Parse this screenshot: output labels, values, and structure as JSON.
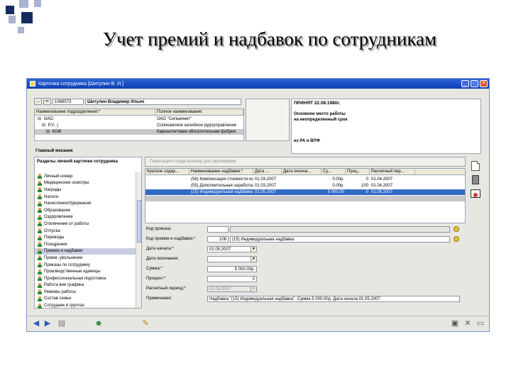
{
  "slide": {
    "title": "Учет премий и надбавок по сотрудникам",
    "colors": {
      "dark_square": "#172c5e",
      "light_square": "#aab3cf"
    }
  },
  "window": {
    "title": "Карточка сотрудника [Шитулин В. И.]",
    "controls": {
      "minimize": "_",
      "maximize": "□",
      "close": "✕"
    }
  },
  "employee": {
    "tab_number": "1068573",
    "name": "Шитулин Владимир Ильич",
    "status_header": "ПРИНЯТ 22.08.1980г.",
    "status_lines": [
      "Основное место работы",
      "на неопределенный срок",
      "из РА и ВПФ"
    ]
  },
  "org_table": {
    "columns": [
      "Наименование подразделения:*",
      "Полное наименование:"
    ],
    "rows": [
      {
        "short": "ОАО",
        "full": "ОАО \"Сильвинит\""
      },
      {
        "short": "Р.У...)",
        "full": "Соликамское калийное рудоуправление"
      },
      {
        "short": "КОФ",
        "full": "Карналлитовая обогатительная фабрик"
      }
    ],
    "position": "Главный механик"
  },
  "sections": {
    "header": "Разделы личной карточки сотрудника",
    "items": [
      "Личный номер",
      "Медицинские осмотры",
      "Награды",
      "Налоги",
      "Начисления/Удержания",
      "Образование",
      "Оздоровление",
      "Отвлечение от работы",
      "Отпуска",
      "Переводы",
      "Поощрения",
      "Премии и надбавки",
      "Прием, увольнение",
      "Приказы по сотруднику",
      "Производственные единицы",
      "Профессиональная подготовка",
      "Работа вне графика",
      "Режимы работы",
      "Состав семьи",
      "Сотрудник в группах"
    ],
    "selected_index": 11
  },
  "group_hint": "Перетащите сюда колонку для группировки",
  "bonus_table": {
    "columns": [
      "Краткое содер...",
      "Наименование надбавки:*",
      "Дата ...",
      "Дата оконча...",
      "Су...",
      "Проц...",
      "Расчетный пер..."
    ],
    "rows": [
      {
        "short": "",
        "name": "(56) Компенсация стоимости комму",
        "start": "01.03.2007",
        "end": "",
        "sum": "0.00р.",
        "pct": "0",
        "period": "01.04.2007",
        "state": "normal"
      },
      {
        "short": "",
        "name": "(55) Дополнительная заработная п",
        "start": "01.03.2007",
        "end": "",
        "sum": "0.00р.",
        "pct": "100",
        "period": "01.04.2007",
        "state": "normal"
      },
      {
        "short": "",
        "name": "(15) Индивидуальная надбавка",
        "start": "01.05.2007",
        "end": "",
        "sum": "5 000.00",
        "pct": "0",
        "period": "01.05.2007",
        "state": "selected"
      },
      {
        "short": "",
        "name": "",
        "start": "",
        "end": "",
        "sum": "",
        "pct": "",
        "period": "",
        "state": "gray"
      }
    ]
  },
  "form": {
    "order_code_label": "Код приказа:",
    "order_code_value": "",
    "bonus_code_label": "Код премии и надбавки:*",
    "bonus_code_value": "108",
    "bonus_name_value": "(15) Индивидуальная надбавка",
    "start_date_label": "Дата начала:*",
    "start_date_value": "01.05.2007",
    "end_date_label": "Дата окончания:",
    "end_date_value": "",
    "sum_label": "Сумма:*",
    "sum_value": "5 000.00р.",
    "percent_label": "Процент:*",
    "percent_value": "0",
    "period_label": "Расчетный период:*",
    "period_value": "01.05.2007",
    "note_label": "Примечание:",
    "note_value": "Надбавка \"(15) Индивидуальная надбавка\". Сумма 5 000.00р. Дата начала 01.05.2007"
  },
  "icons": {
    "right_toolbar": [
      "new-document-icon",
      "trash-icon",
      "print-icon"
    ],
    "bottom_toolbar": [
      "back-icon",
      "forward-icon",
      "printer-icon",
      "people-icon",
      "edit-person-icon",
      "save-icon",
      "close-icon",
      "window-icon"
    ]
  }
}
